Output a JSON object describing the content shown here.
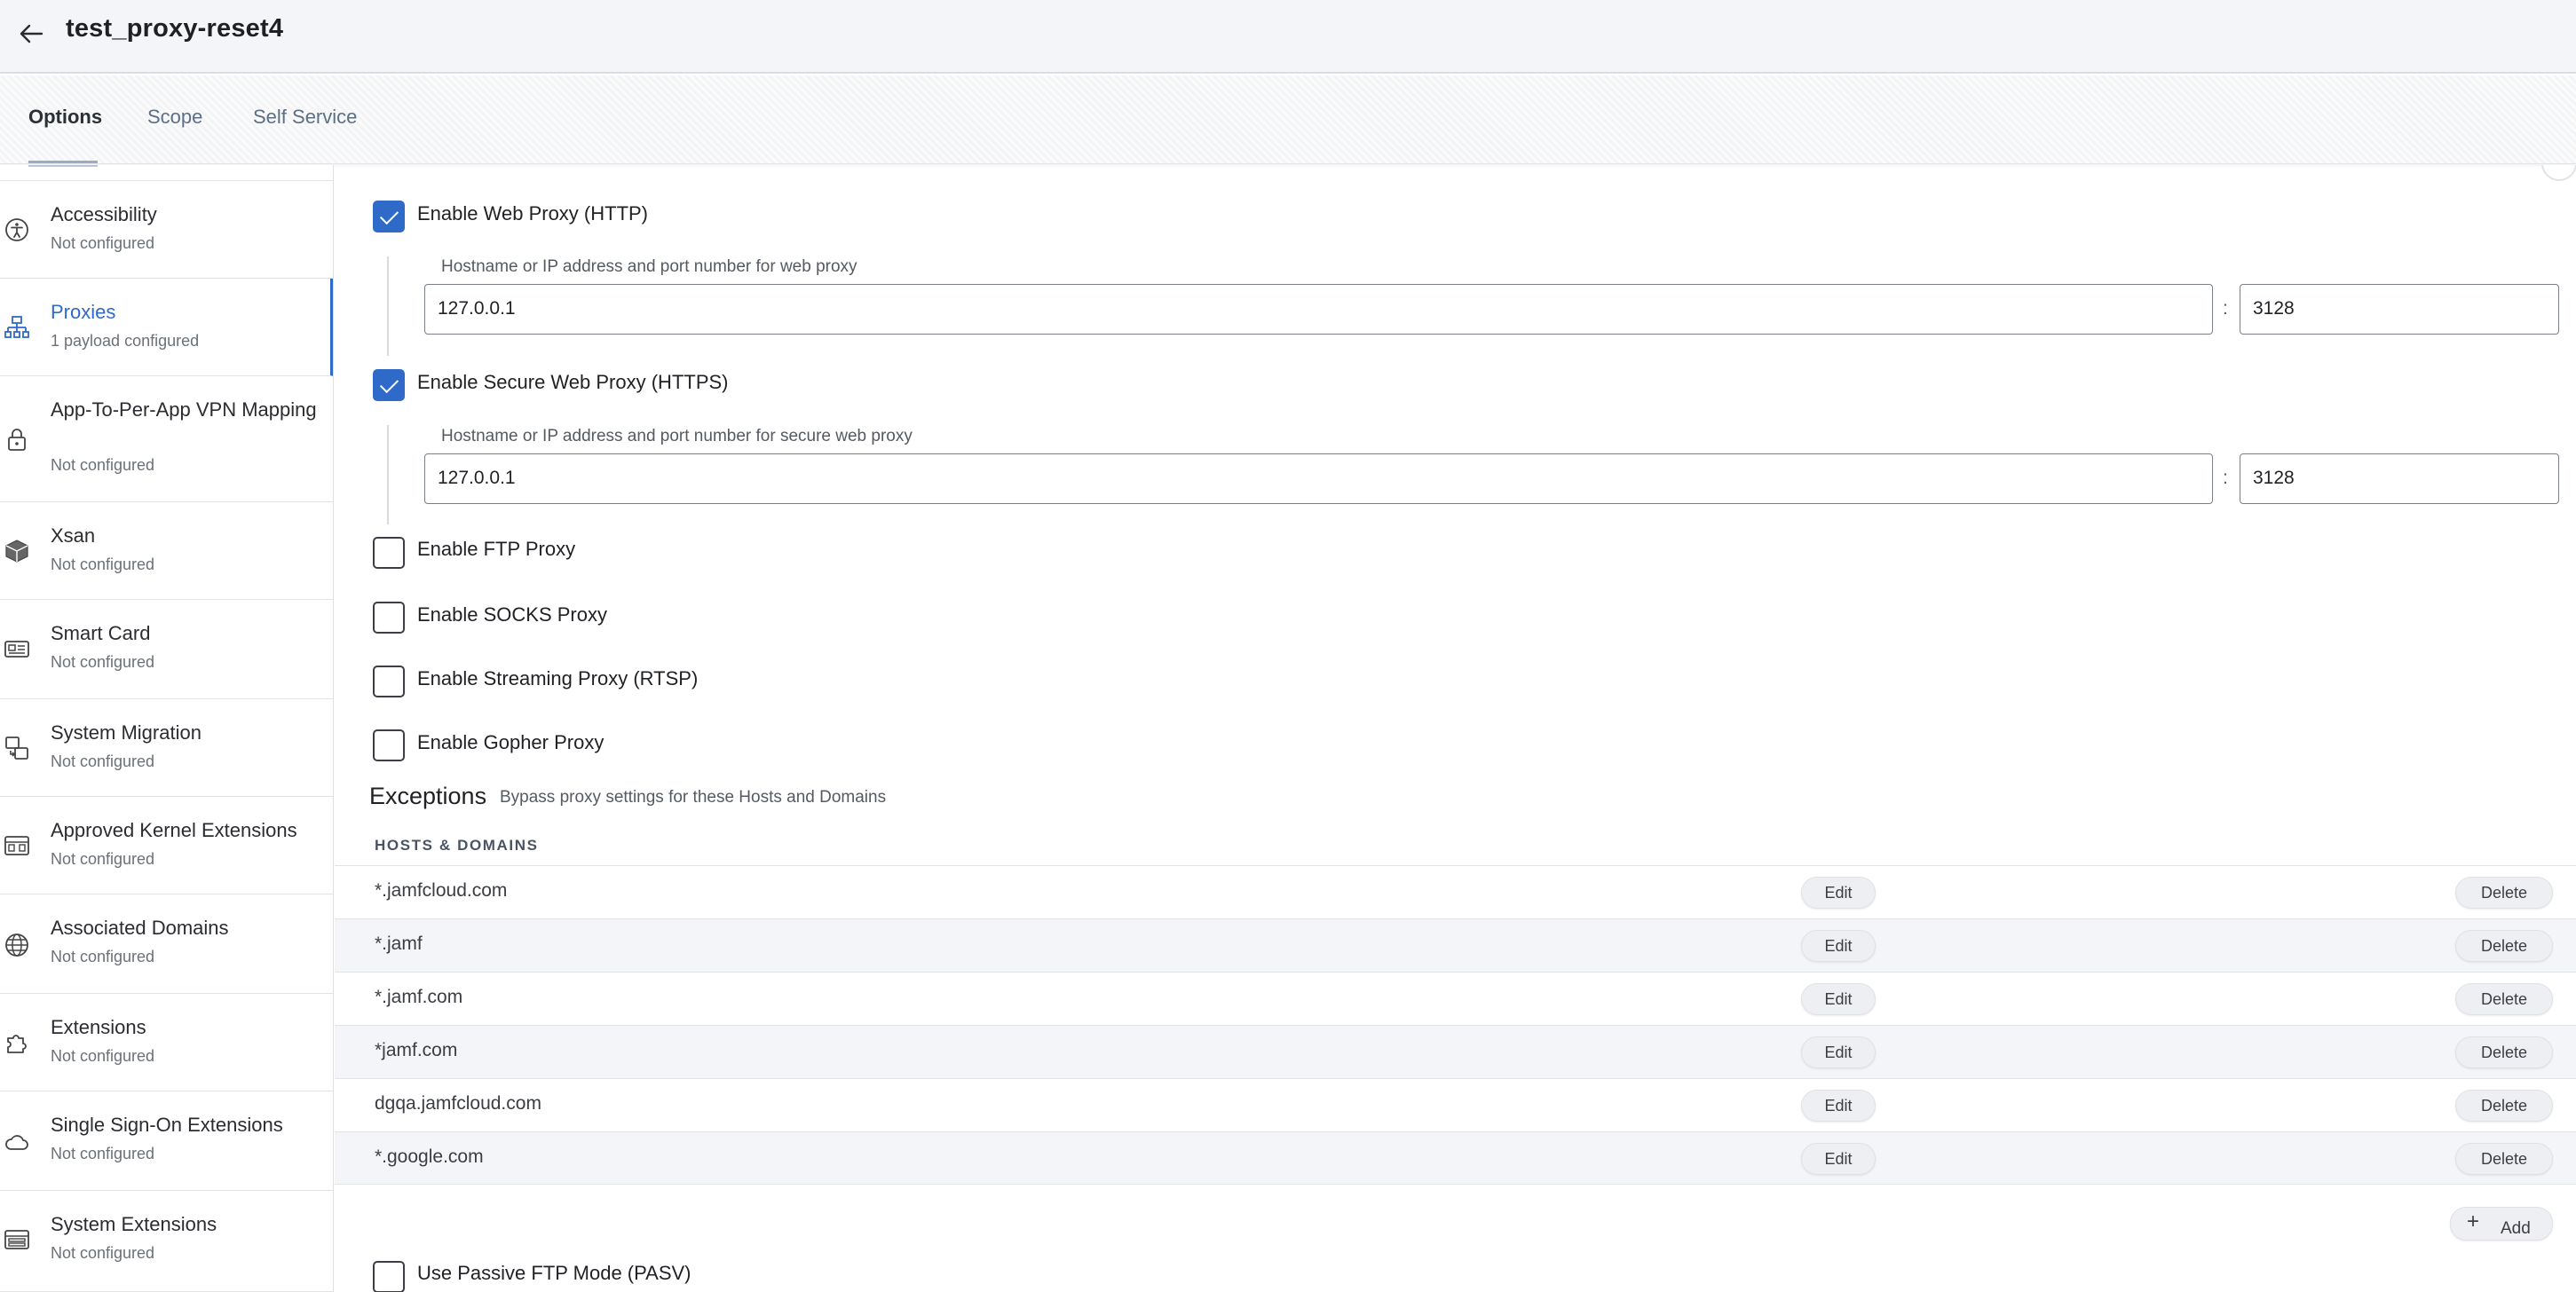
{
  "header": {
    "title": "test_proxy-reset4"
  },
  "tabs": [
    {
      "label": "Options"
    },
    {
      "label": "Scope"
    },
    {
      "label": "Self Service"
    }
  ],
  "sidebar": {
    "items": [
      {
        "title": "Accessibility",
        "subtitle": "Not configured",
        "icon": "accessibility-icon"
      },
      {
        "title": "Proxies",
        "subtitle": "1 payload configured",
        "icon": "network-icon"
      },
      {
        "title": "App-To-Per-App VPN Mapping",
        "subtitle": "Not configured",
        "icon": "lock-icon"
      },
      {
        "title": "Xsan",
        "subtitle": "Not configured",
        "icon": "box-icon"
      },
      {
        "title": "Smart Card",
        "subtitle": "Not configured",
        "icon": "smart-card-icon"
      },
      {
        "title": "System Migration",
        "subtitle": "Not configured",
        "icon": "migration-icon"
      },
      {
        "title": "Approved Kernel Extensions",
        "subtitle": "Not configured",
        "icon": "kernel-icon"
      },
      {
        "title": "Associated Domains",
        "subtitle": "Not configured",
        "icon": "globe-icon"
      },
      {
        "title": "Extensions",
        "subtitle": "Not configured",
        "icon": "puzzle-icon"
      },
      {
        "title": "Single Sign-On Extensions",
        "subtitle": "Not configured",
        "icon": "cloud-icon"
      },
      {
        "title": "System Extensions",
        "subtitle": "Not configured",
        "icon": "extensions-icon"
      }
    ]
  },
  "proxy": {
    "web": {
      "label": "Enable Web Proxy (HTTP)",
      "checked": true,
      "field_label": "Hostname or IP address and port number for web proxy",
      "host": "127.0.0.1",
      "port": "3128"
    },
    "secure": {
      "label": "Enable Secure Web Proxy (HTTPS)",
      "checked": true,
      "field_label": "Hostname or IP address and port number for secure web proxy",
      "host": "127.0.0.1",
      "port": "3128"
    },
    "colon": ":",
    "ftp": {
      "label": "Enable FTP Proxy",
      "checked": false
    },
    "socks": {
      "label": "Enable SOCKS Proxy",
      "checked": false
    },
    "rtsp": {
      "label": "Enable Streaming Proxy (RTSP)",
      "checked": false
    },
    "gopher": {
      "label": "Enable Gopher Proxy",
      "checked": false
    },
    "passive_ftp": {
      "label": "Use Passive FTP Mode (PASV)",
      "checked": false
    }
  },
  "exceptions": {
    "title": "Exceptions",
    "description": "Bypass proxy settings for these Hosts and Domains",
    "column_header": "HOSTS & DOMAINS",
    "rows": [
      "*.jamfcloud.com",
      "*.jamf",
      "*.jamf.com",
      "*jamf.com",
      "dgqa.jamfcloud.com",
      "*.google.com"
    ],
    "edit_label": "Edit",
    "delete_label": "Delete",
    "add_label": "Add",
    "add_plus": "+"
  },
  "colors": {
    "accent": "#2f6ac8",
    "alt_row": "#f4f5f8",
    "header_bg": "#f4f5f8"
  }
}
